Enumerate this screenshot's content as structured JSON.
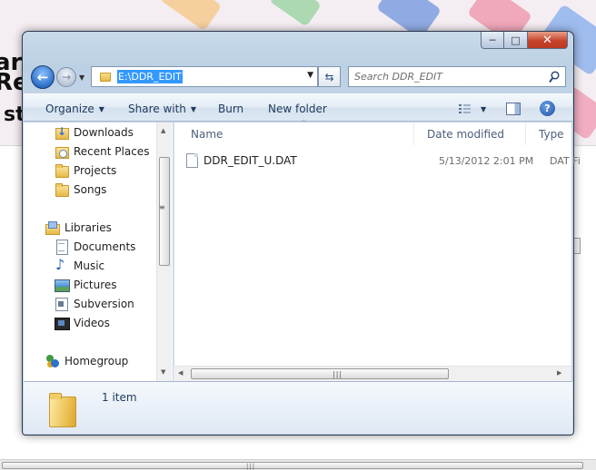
{
  "window": {
    "address_path": "E:\\DDR_EDIT",
    "search_placeholder": "Search DDR_EDIT",
    "caption": {
      "minimize": "─",
      "maximize": "□",
      "close": "✕"
    }
  },
  "toolbar": {
    "organize": "Organize",
    "share_with": "Share with",
    "burn": "Burn",
    "new_folder": "New folder"
  },
  "nav": {
    "favorites": [
      {
        "label": "Downloads",
        "icon": "downloads-folder-icon"
      },
      {
        "label": "Recent Places",
        "icon": "recent-places-icon"
      },
      {
        "label": "Projects",
        "icon": "folder-icon"
      },
      {
        "label": "Songs",
        "icon": "folder-icon"
      }
    ],
    "libraries": {
      "label": "Libraries",
      "items": [
        {
          "label": "Documents",
          "icon": "documents-icon"
        },
        {
          "label": "Music",
          "icon": "music-icon"
        },
        {
          "label": "Pictures",
          "icon": "pictures-icon"
        },
        {
          "label": "Subversion",
          "icon": "subversion-icon"
        },
        {
          "label": "Videos",
          "icon": "videos-icon"
        }
      ]
    },
    "homegroup": "Homegroup"
  },
  "columns": {
    "name": "Name",
    "date_modified": "Date modified",
    "type": "Type"
  },
  "files": [
    {
      "name": "DDR_EDIT_U.DAT",
      "date_modified": "5/13/2012 2:01 PM",
      "type": "DAT Fi"
    }
  ],
  "details": {
    "count": "1 item"
  },
  "background": {
    "logo_line1": "ar",
    "logo_line2": "Re",
    "logo_line3": "st"
  }
}
